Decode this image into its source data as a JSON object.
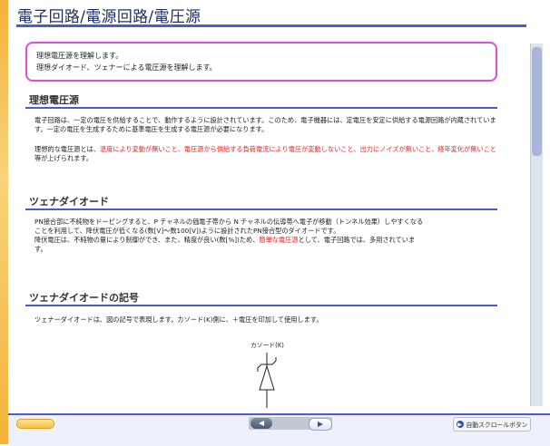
{
  "header": {
    "title": "電子回路/電源回路/電圧源"
  },
  "objectives": [
    "理想電圧源を理解します。",
    "理想ダイオード、ツェナーによる電圧源を理解します。"
  ],
  "sections": [
    {
      "title": "理想電圧源",
      "paragraphs": [
        "電子回路は、一定の電圧を供給することで、動作するように設計されています。このため、電子機器には、定電圧を安定に供給する電源回路が内蔵されています。一定の電圧を生成するために基準電圧を生成する電圧源が必要になります。",
        "理想的な電圧源とは、温度により変動が無いこと、電圧源から供給する負荷電流により電圧が変動しないこと、出力にノイズが無いこと、経年変化が無いこと等が上げられます。"
      ],
      "paragraph2_parts": {
        "prefix": "理想的な電圧源とは、",
        "red1": "温度により変動が無いこと、電圧源から供給する負荷電流により電圧が変動しないこと、出力にノイズが無いこと、経年変化が無いこと",
        "suffix": "等が上げられます。"
      }
    },
    {
      "title": "ツェナダイオード",
      "paragraph_parts": {
        "line1": "PN接合部に不純物をドーピングすると、P チャネルの価電子帯から N チャネルの伝導帯へ電子が移動（トンネル効果）しやすくなる",
        "line2": "ことを利用して、降伏電圧が低くなる(数[V]〜数100[V])ように設計されたPN接合型のダイオードです。",
        "line3a": "降伏電圧は、不純物の量により制御ができ、また、精度が良い(数[%])ため、",
        "line3red": "簡単な電圧源",
        "line3b": "として、電子回路では、多用されていま",
        "line4": "す。"
      }
    },
    {
      "title": "ツェナダイオードの記号",
      "paragraph": "ツェナーダイオードは、図の記号で表現します。カソード(K)側に、＋電圧を印加して使用します。",
      "diagram_label": "カソード(K)"
    }
  ],
  "footer": {
    "auto_scroll_label": "自動スクロールボタン",
    "progress": 0.07
  },
  "colors": {
    "accent": "#4a5bd1",
    "objective_border": "#e24bd9",
    "highlight": "#ff1a1a",
    "left_strip": "#f4b23a"
  },
  "icons": {
    "prev": "triangle-left-icon",
    "next": "triangle-right-icon",
    "auto": "play-circle-icon"
  }
}
